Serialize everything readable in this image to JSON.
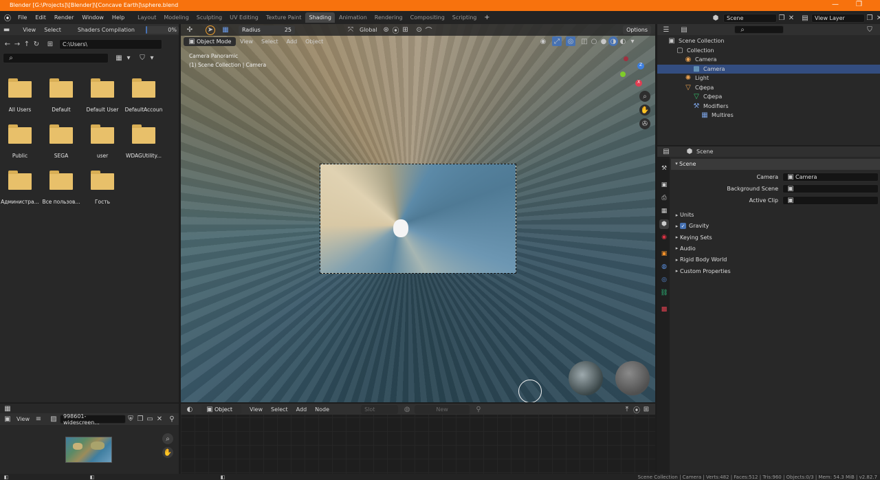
{
  "window": {
    "title": "Blender [G:\\Projects]\\[Blender]\\[Concave Earth]\\sphere.blend",
    "min_glyph": "—",
    "max_glyph": "❐",
    "close_glyph": "✕"
  },
  "topbar": {
    "menus": [
      "File",
      "Edit",
      "Render",
      "Window",
      "Help"
    ],
    "workspaces": [
      "Layout",
      "Modeling",
      "Sculpting",
      "UV Editing",
      "Texture Paint",
      "Shading",
      "Animation",
      "Rendering",
      "Compositing",
      "Scripting"
    ],
    "active_workspace": "Shading",
    "add_tab": "+",
    "scene": "Scene",
    "view_layer": "View Layer"
  },
  "filebrowser": {
    "menus": [
      "View",
      "Select"
    ],
    "task": "Shaders Compilation",
    "progress_percent": 0,
    "progress_label": "0%",
    "path": "C:\\Users\\",
    "folders": [
      "All Users",
      "Default",
      "Default User",
      "DefaultAccoun",
      "Public",
      "SEGA",
      "user",
      "WDAGUtility...",
      "Администра...",
      "Все пользов...",
      "Гость"
    ]
  },
  "imageeditor": {
    "view_label": "View",
    "image_name": "998601-widescreen..."
  },
  "viewport": {
    "mode": "Object Mode",
    "menus": [
      "View",
      "Select",
      "Add",
      "Object"
    ],
    "radius_label": "Radius",
    "radius_value": "25",
    "orientation": "Global",
    "options": "Options",
    "camera_name": "Camera Panoramic",
    "collection_info": "(1) Scene Collection | Camera",
    "gizmo_axes": {
      "x": "X",
      "z": "Z"
    }
  },
  "shader_editor": {
    "type": "Object",
    "menus": [
      "View",
      "Select",
      "Add",
      "Node"
    ],
    "slot": "Slot",
    "new_label": "New"
  },
  "outliner": {
    "items": [
      {
        "label": "Scene Collection",
        "depth": 0,
        "icon": "scene-collection-icon"
      },
      {
        "label": "Collection",
        "depth": 1,
        "icon": "collection-icon"
      },
      {
        "label": "Camera",
        "depth": 2,
        "icon": "camera-object-icon"
      },
      {
        "label": "Camera",
        "depth": 3,
        "icon": "camera-data-icon",
        "selected": true
      },
      {
        "label": "Light",
        "depth": 2,
        "icon": "light-icon"
      },
      {
        "label": "Сфера",
        "depth": 2,
        "icon": "mesh-object-icon"
      },
      {
        "label": "Сфера",
        "depth": 3,
        "icon": "mesh-data-icon"
      },
      {
        "label": "Modifiers",
        "depth": 3,
        "icon": "wrench-icon"
      },
      {
        "label": "Multires",
        "depth": 4,
        "icon": "multires-icon"
      }
    ]
  },
  "properties": {
    "context": "Scene",
    "panel_title": "Scene",
    "fields": [
      {
        "label": "Camera",
        "value": "Camera"
      },
      {
        "label": "Background Scene",
        "value": ""
      },
      {
        "label": "Active Clip",
        "value": ""
      }
    ],
    "subpanels": [
      "Units",
      "Gravity",
      "Keying Sets",
      "Audio",
      "Rigid Body World",
      "Custom Properties"
    ],
    "gravity_checked": true
  },
  "statusbar": {
    "text": "Scene Collection | Camera | Verts:482 | Faces:512 | Tris:960 | Objects:0/3 | Mem: 54.3 MiB | v2.82.7"
  },
  "colors": {
    "accent": "#f7720d",
    "selection": "#334d80",
    "panel": "#303030",
    "folder": "#e8c06a"
  }
}
